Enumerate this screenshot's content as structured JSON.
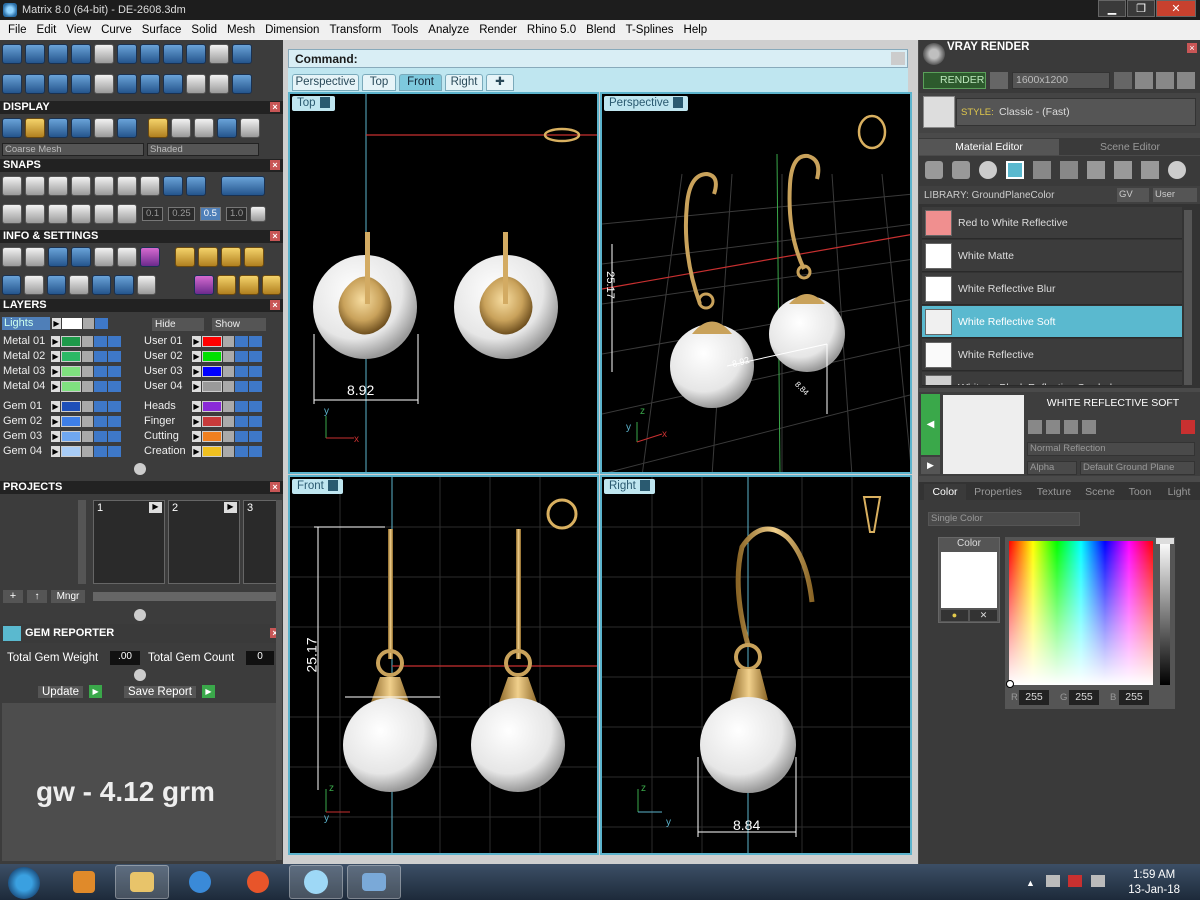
{
  "titlebar": {
    "title": "Matrix 8.0 (64-bit) - DE-2608.3dm",
    "minimize": "▁",
    "maximize": "❐",
    "close": "✕"
  },
  "menu": [
    "File",
    "Edit",
    "View",
    "Curve",
    "Surface",
    "Solid",
    "Mesh",
    "Dimension",
    "Transform",
    "Tools",
    "Analyze",
    "Render",
    "Rhino 5.0",
    "Blend",
    "T-Splines",
    "Help"
  ],
  "left": {
    "display": {
      "title": "DISPLAY",
      "mesh_value": "Coarse Mesh",
      "shade_value": "Shaded"
    },
    "snaps": {
      "title": "SNAPS",
      "values": [
        "0.1",
        "0.25",
        "0.5",
        "1.0"
      ],
      "active_index": 2
    },
    "info": {
      "title": "INFO & SETTINGS"
    },
    "layers": {
      "title": "LAYERS",
      "lights": "Lights",
      "hide": "Hide",
      "show": "Show",
      "left_col": [
        {
          "name": "Metal 01",
          "color": "#1e9a4a"
        },
        {
          "name": "Metal 02",
          "color": "#2bb865"
        },
        {
          "name": "Metal 03",
          "color": "#7fe07f"
        },
        {
          "name": "Metal 04",
          "color": "#7fe07f"
        },
        {
          "name": "Gem 01",
          "color": "#1e4fb8"
        },
        {
          "name": "Gem 02",
          "color": "#3e7fe8"
        },
        {
          "name": "Gem 03",
          "color": "#6fa7f0"
        },
        {
          "name": "Gem 04",
          "color": "#a8ccf6"
        }
      ],
      "right_col": [
        {
          "name": "User 01",
          "color": "#ff0000"
        },
        {
          "name": "User 02",
          "color": "#00e000"
        },
        {
          "name": "User 03",
          "color": "#0000ff"
        },
        {
          "name": "User 04",
          "color": "#9a9a9a"
        },
        {
          "name": "Heads",
          "color": "#8a2ad8"
        },
        {
          "name": "Finger",
          "color": "#c83a3a"
        },
        {
          "name": "Cutting",
          "color": "#f08020"
        },
        {
          "name": "Creation",
          "color": "#f0c020"
        }
      ]
    },
    "projects": {
      "title": "PROJECTS",
      "slots": [
        "1",
        "2",
        "3"
      ],
      "mngr": "Mngr"
    },
    "gem": {
      "title": "GEM REPORTER",
      "weight_label": "Total Gem Weight",
      "weight_value": ".00",
      "count_label": "Total Gem Count",
      "count_value": "0",
      "update": "Update",
      "save": "Save Report",
      "note": "gw - 4.12 grm"
    }
  },
  "main": {
    "command_label": "Command:",
    "tabs": [
      "Perspective",
      "Top",
      "Front",
      "Right"
    ],
    "active_tab": "Front",
    "viewports": {
      "top": {
        "label": "Top",
        "dim": "8.92"
      },
      "perspective": {
        "label": "Perspective",
        "dim1": "25.17",
        "dim2": "8.92",
        "dim3": "8.84"
      },
      "front": {
        "label": "Front",
        "dim": "25.17"
      },
      "right": {
        "label": "Right",
        "dim": "8.84"
      }
    }
  },
  "vray": {
    "title": "VRAY RENDER",
    "render": "RENDER",
    "resolution": "1600x1200",
    "style_label": "STYLE:",
    "style_value": "Classic - (Fast)",
    "tabs": [
      "Material Editor",
      "Scene Editor"
    ],
    "library_label": "LIBRARY: GroundPlaneColor",
    "gv": "GV",
    "user": "User",
    "materials": [
      {
        "name": "Red to White Reflective",
        "color": "#f08f8f"
      },
      {
        "name": "White Matte",
        "color": "#ffffff"
      },
      {
        "name": "White Reflective Blur",
        "color": "#ffffff"
      },
      {
        "name": "White Reflective Soft",
        "color": "#f0f0f0"
      },
      {
        "name": "White Reflective",
        "color": "#fafafa"
      },
      {
        "name": "White to Black Reflective Graded",
        "color": "#d0d0d0"
      }
    ],
    "selected_material": "WHITE REFLECTIVE SOFT",
    "reflection": "Normal Reflection",
    "alpha": "Alpha",
    "ground": "Default Ground Plane",
    "subtabs": [
      "Color",
      "Properties",
      "Texture",
      "Scene",
      "Toon",
      "Light"
    ],
    "color_mode": "Single Color",
    "color_label": "Color",
    "rgb": {
      "r_label": "R",
      "r": "255",
      "g_label": "G",
      "g": "255",
      "b_label": "B",
      "b": "255"
    }
  },
  "taskbar": {
    "time": "1:59 AM",
    "date": "13-Jan-18"
  },
  "colors": {
    "accent": "#5ab9cf",
    "viewport_border": "#5cb3cc",
    "gold": "#c9a25b"
  }
}
